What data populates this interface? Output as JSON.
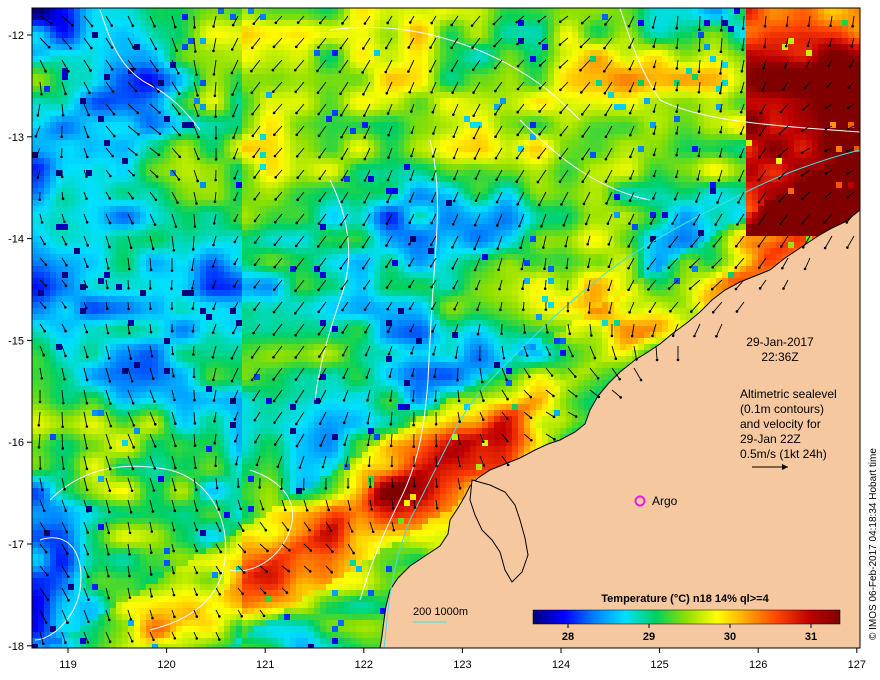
{
  "map": {
    "date": "29-Jan-2017",
    "time": "22:36Z",
    "altimetry_lines": [
      "Altimetric sealevel",
      "(0.1m contours)",
      "and velocity for",
      "29-Jan 22Z",
      "0.5m/s (1kt 24h)"
    ],
    "argo_label": "Argo",
    "depth_contours_label": "200  1000m",
    "credit": "© IMOS 06-Feb-2017 04:18:34 Hobart time",
    "x_ticks": [
      "119",
      "120",
      "121",
      "122",
      "123",
      "124",
      "125",
      "126",
      "127"
    ],
    "y_ticks": [
      "-12",
      "-13",
      "-14",
      "-15",
      "-16",
      "-17",
      "-18"
    ],
    "colors": {
      "land": "#f6c8a0",
      "coast": "#000000",
      "contour": "#ffffff",
      "argo": "#e020e0",
      "depth200": "#40e0e0"
    }
  },
  "legend": {
    "title": "Temperature (°C) n18 14% ql>=4",
    "ticks": [
      "28",
      "29",
      "30",
      "31"
    ],
    "stops": [
      "#00007a",
      "#0000ff",
      "#0080ff",
      "#00e0ff",
      "#00d060",
      "#90e000",
      "#ffff00",
      "#ffa000",
      "#ff4000",
      "#c00000",
      "#800000"
    ]
  }
}
